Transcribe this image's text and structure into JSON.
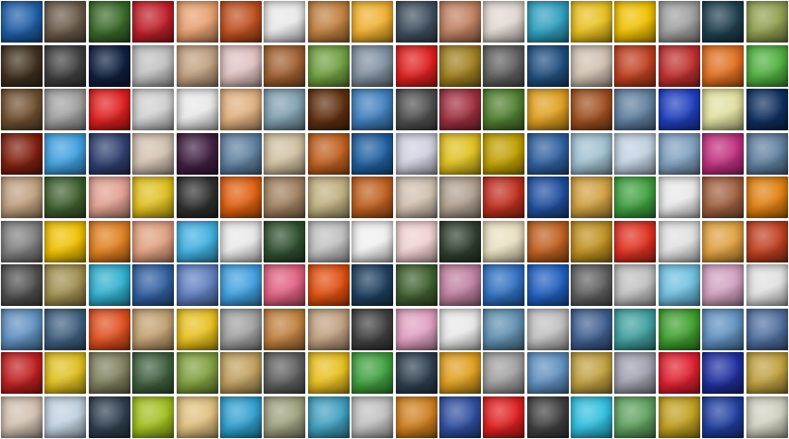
{
  "mosaic": {
    "rows": 10,
    "columns": 18,
    "tiles": [
      [
        "#1f5fa8",
        "#6b5a4a",
        "#3a6a2a",
        "#c0202a",
        "#e8a070",
        "#c05020",
        "#e8e8e8",
        "#c08040",
        "#f0b030",
        "#405060",
        "#c08060",
        "#e0d8d0",
        "#30a0c0",
        "#e8c020",
        "#f0c000",
        "#a0a0a0",
        "#204050",
        "#90a050"
      ],
      [
        "#403020",
        "#404040",
        "#102040",
        "#c0c0c0",
        "#c0a080",
        "#e0c0c0",
        "#a06030",
        "#70a040",
        "#8090a0",
        "#e02020",
        "#a08020",
        "#606060",
        "#205080",
        "#d0c0b0",
        "#c04020",
        "#c03030",
        "#e07020",
        "#50b040"
      ],
      [
        "#705030",
        "#a0a0a0",
        "#e02020",
        "#d0d0d0",
        "#e8e8e8",
        "#e0b080",
        "#80a0b0",
        "#603010",
        "#4080c0",
        "#505050",
        "#a03040",
        "#508030",
        "#e0a020",
        "#a05020",
        "#6080a0",
        "#2040c0",
        "#e0e0a0",
        "#103060"
      ],
      [
        "#802010",
        "#40a0e0",
        "#304070",
        "#d0c0b0",
        "#402040",
        "#6080a0",
        "#d0c0a0",
        "#c06020",
        "#2060a0",
        "#d0d0e0",
        "#e0c020",
        "#c0a000",
        "#3060a0",
        "#a0c0d0",
        "#c0d0e0",
        "#80a0c0",
        "#c03080",
        "#6080a0"
      ],
      [
        "#c0a080",
        "#406030",
        "#e0a090",
        "#e0c020",
        "#303030",
        "#e06010",
        "#a08060",
        "#c0b080",
        "#c06020",
        "#d0c0b0",
        "#b0a090",
        "#c03020",
        "#2050a0",
        "#d0a040",
        "#40a040",
        "#e8e8e8",
        "#a06040",
        "#e08010"
      ],
      [
        "#808080",
        "#f0c000",
        "#e08020",
        "#e0a080",
        "#40b0e0",
        "#e8e8e8",
        "#305030",
        "#c0c0c0",
        "#f0f0f0",
        "#f0d0d0",
        "#304030",
        "#e8e0c0",
        "#c06020",
        "#c09020",
        "#e03020",
        "#e0e0e0",
        "#e0a040",
        "#c04020"
      ],
      [
        "#505050",
        "#a09050",
        "#30b0d0",
        "#3060a0",
        "#6080c0",
        "#40a0e0",
        "#e06080",
        "#e05010",
        "#204060",
        "#406030",
        "#c080a0",
        "#3070c0",
        "#2060c0",
        "#606060",
        "#c0c0c0",
        "#70c0e0",
        "#d0a0c0",
        "#e0e0e0"
      ],
      [
        "#6090c0",
        "#406080",
        "#e05020",
        "#c0a070",
        "#e8c020",
        "#a0a0a0",
        "#c08040",
        "#c0a080",
        "#404040",
        "#e0a0c0",
        "#e8e8e8",
        "#6090b0",
        "#c0c0c0",
        "#406090",
        "#40a0a0",
        "#40a030",
        "#6090c0",
        "#5070a0"
      ],
      [
        "#c02020",
        "#e0c020",
        "#808060",
        "#406040",
        "#80a040",
        "#c0a060",
        "#606060",
        "#e8c020",
        "#40a040",
        "#304050",
        "#e0a020",
        "#a0a0a0",
        "#6090c0",
        "#c0a040",
        "#a0a0b0",
        "#e02030",
        "#2030a0",
        "#c0a040"
      ],
      [
        "#d0c0b0",
        "#c0d0e0",
        "#304050",
        "#a0c020",
        "#e0c080",
        "#30a0d0",
        "#a0a080",
        "#40a0c0",
        "#c0c0c0",
        "#d08020",
        "#3050a0",
        "#e02020",
        "#404040",
        "#30c0e0",
        "#60a060",
        "#c0a020",
        "#2040a0",
        "#d0d0c0"
      ]
    ]
  }
}
